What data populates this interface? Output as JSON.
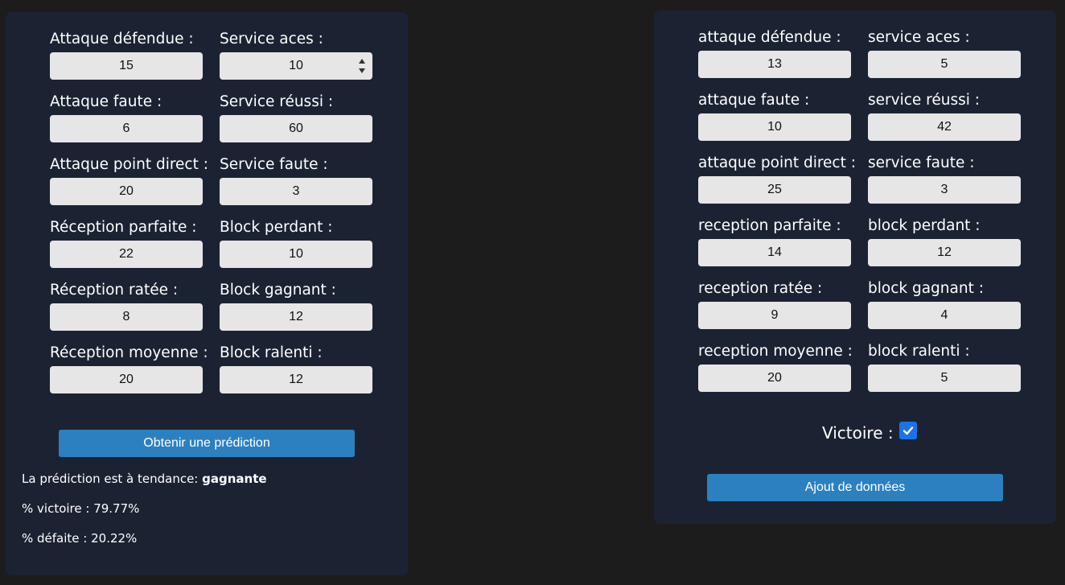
{
  "prediction_form": {
    "fields": [
      {
        "label": "Attaque défendue :",
        "value": "15"
      },
      {
        "label": "Service aces :",
        "value": "10"
      },
      {
        "label": "Attaque faute :",
        "value": "6"
      },
      {
        "label": "Service réussi :",
        "value": "60"
      },
      {
        "label": "Attaque point direct :",
        "value": "20"
      },
      {
        "label": "Service faute :",
        "value": "3"
      },
      {
        "label": "Réception parfaite :",
        "value": "22"
      },
      {
        "label": "Block perdant :",
        "value": "10"
      },
      {
        "label": "Réception ratée :",
        "value": "8"
      },
      {
        "label": "Block gagnant :",
        "value": "12"
      },
      {
        "label": "Réception moyenne :",
        "value": "20"
      },
      {
        "label": "Block ralenti :",
        "value": "12"
      }
    ],
    "button_label": "Obtenir une prédiction",
    "result": {
      "trend_prefix": "La prédiction est à tendance: ",
      "trend_value": "gagnante",
      "win_text": "% victoire : 79.77%",
      "loss_text": "% défaite : 20.22%"
    }
  },
  "data_form": {
    "fields": [
      {
        "label": "attaque défendue :",
        "value": "13"
      },
      {
        "label": "service aces :",
        "value": "5"
      },
      {
        "label": "attaque faute :",
        "value": "10"
      },
      {
        "label": "service réussi :",
        "value": "42"
      },
      {
        "label": "attaque point direct :",
        "value": "25"
      },
      {
        "label": "service faute :",
        "value": "3"
      },
      {
        "label": "reception parfaite :",
        "value": "14"
      },
      {
        "label": "block perdant :",
        "value": "12"
      },
      {
        "label": "reception ratée :",
        "value": "9"
      },
      {
        "label": "block gagnant :",
        "value": "4"
      },
      {
        "label": "reception moyenne :",
        "value": "20"
      },
      {
        "label": "block ralenti :",
        "value": "5"
      }
    ],
    "victory_label": "Victoire :",
    "victory_checked": true,
    "button_label": "Ajout de données"
  },
  "colors": {
    "page_bg": "#1c1c1c",
    "panel_bg": "#1b2333",
    "input_bg": "#e6e6e6",
    "button_bg": "#2d80bf",
    "checkbox_bg": "#1a73e8"
  },
  "icons": {
    "spinner": "number-spinner-icon",
    "checkbox": "checkmark-icon"
  }
}
